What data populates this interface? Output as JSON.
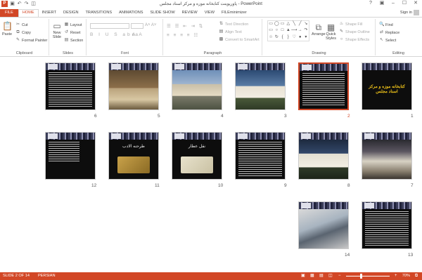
{
  "window": {
    "title": "پاورپوینت کتابخانه موزه و مرکز اسناد مجلس - PowerPoint",
    "controls": [
      "?",
      "▣",
      "–",
      "☐",
      "✕"
    ]
  },
  "tabs": [
    {
      "label": "FILE"
    },
    {
      "label": "HOME"
    },
    {
      "label": "INSERT"
    },
    {
      "label": "DESIGN"
    },
    {
      "label": "TRANSITIONS"
    },
    {
      "label": "ANIMATIONS"
    },
    {
      "label": "SLIDE SHOW"
    },
    {
      "label": "REVIEW"
    },
    {
      "label": "VIEW"
    },
    {
      "label": "FILEminimizer"
    }
  ],
  "signin": "Sign in",
  "ribbon": {
    "clipboard": {
      "paste": "Paste",
      "cut": "Cut",
      "copy": "Copy",
      "format_painter": "Format Painter",
      "label": "Clipboard"
    },
    "slides": {
      "new_slide": "New",
      "new_slide2": "Slide",
      "layout": "Layout",
      "reset": "Reset",
      "section": "Section",
      "label": "Slides"
    },
    "font": {
      "label": "Font"
    },
    "paragraph": {
      "text_direction": "Text Direction",
      "align_text": "Align Text",
      "convert_smartart": "Convert to SmartArt",
      "label": "Paragraph"
    },
    "drawing": {
      "arrange": "Arrange",
      "quick_styles": "Quick",
      "quick_styles2": "Styles",
      "shape_fill": "Shape Fill",
      "shape_outline": "Shape Outline",
      "shape_effects": "Shape Effects",
      "label": "Drawing"
    },
    "editing": {
      "find": "Find",
      "replace": "Replace",
      "select": "Select",
      "label": "Editing"
    }
  },
  "slides": [
    {
      "num": "1",
      "kind": "title",
      "title": "کتابخانه موزه و مرکز اسناد مجلس"
    },
    {
      "num": "2",
      "kind": "text",
      "selected": true
    },
    {
      "num": "3",
      "kind": "photo-building"
    },
    {
      "num": "4",
      "kind": "photo-building2"
    },
    {
      "num": "5",
      "kind": "photo-interior"
    },
    {
      "num": "6",
      "kind": "text"
    },
    {
      "num": "7",
      "kind": "photo-hall"
    },
    {
      "num": "8",
      "kind": "photo-building3"
    },
    {
      "num": "9",
      "kind": "text"
    },
    {
      "num": "10",
      "kind": "book",
      "title": "نقل عطار"
    },
    {
      "num": "11",
      "kind": "book",
      "title": "طرحنه الادب"
    },
    {
      "num": "12",
      "kind": "text"
    },
    {
      "num": "13",
      "kind": "text"
    },
    {
      "num": "14",
      "kind": "photo-laptop"
    }
  ],
  "status": {
    "slide": "SLIDE 2 OF 14",
    "language": "PERSIAN",
    "zoom": "70%",
    "zoom_fraction": 0.7
  },
  "colors": {
    "accent": "#d24726",
    "slide_bg": "#0d0d0d",
    "title_gold": "#f0c419"
  }
}
